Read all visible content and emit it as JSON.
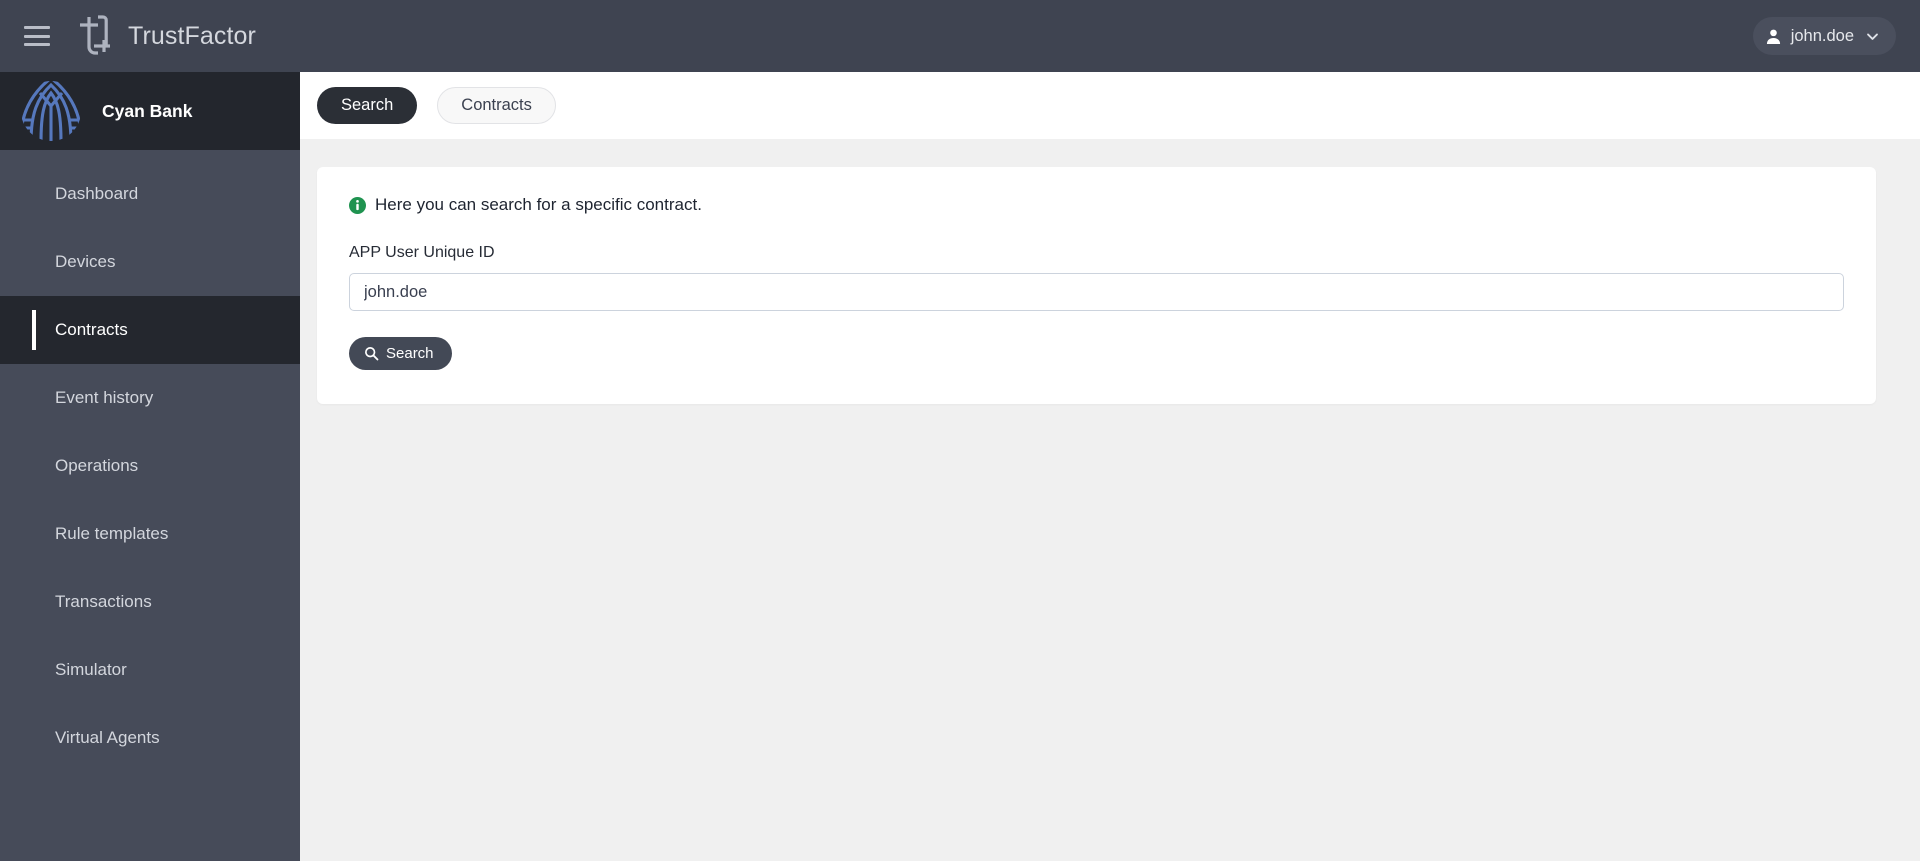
{
  "topbar": {
    "menu_icon": "hamburger-icon",
    "app_logo_icon": "trustfactor-logo-icon",
    "app_name": "TrustFactor",
    "user": {
      "avatar_icon": "person-icon",
      "name": "john.doe",
      "chevron_icon": "chevron-down-icon"
    }
  },
  "sidebar": {
    "tenant_logo_icon": "cyan-bank-logo-icon",
    "tenant_name": "Cyan Bank",
    "items": [
      {
        "label": "Dashboard",
        "active": false
      },
      {
        "label": "Devices",
        "active": false
      },
      {
        "label": "Contracts",
        "active": true
      },
      {
        "label": "Event history",
        "active": false
      },
      {
        "label": "Operations",
        "active": false
      },
      {
        "label": "Rule templates",
        "active": false
      },
      {
        "label": "Transactions",
        "active": false
      },
      {
        "label": "Simulator",
        "active": false
      },
      {
        "label": "Virtual Agents",
        "active": false
      }
    ]
  },
  "main": {
    "tabs": [
      {
        "label": "Search",
        "active": true
      },
      {
        "label": "Contracts",
        "active": false
      }
    ],
    "card": {
      "info_icon": "info-circle-icon",
      "info_message": "Here you can search for a specific contract.",
      "field": {
        "label": "APP User Unique ID",
        "value": "john.doe",
        "placeholder": ""
      },
      "submit": {
        "icon": "search-icon",
        "label": "Search"
      }
    }
  },
  "colors": {
    "topbar_bg": "#3f4451",
    "sidebar_bg": "#464b59",
    "sidebar_logo_bg": "#23262d",
    "nav_active_bg": "#24272e",
    "tab_active_bg": "#2b2f36",
    "button_bg": "#434956",
    "info_green": "#1f9350",
    "brand_blue": "#5678bd",
    "page_bg": "#f0f0f0"
  }
}
